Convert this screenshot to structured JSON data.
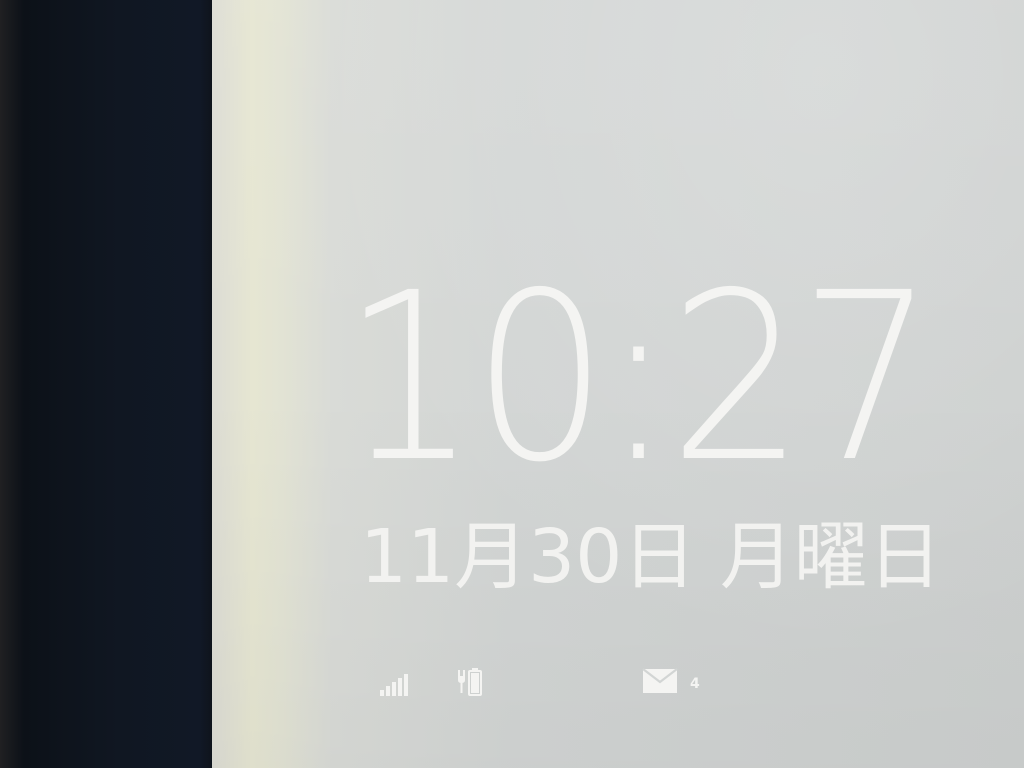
{
  "lock_screen": {
    "time": "10:27",
    "date": "11月30日 月曜日",
    "status": {
      "signal_icon": "signal-strength-icon",
      "battery_icon": "battery-charging-icon",
      "mail_icon": "mail-icon",
      "mail_count": "4"
    }
  },
  "colors": {
    "text": "#f4f4f2",
    "background": "#d2d5d4"
  }
}
